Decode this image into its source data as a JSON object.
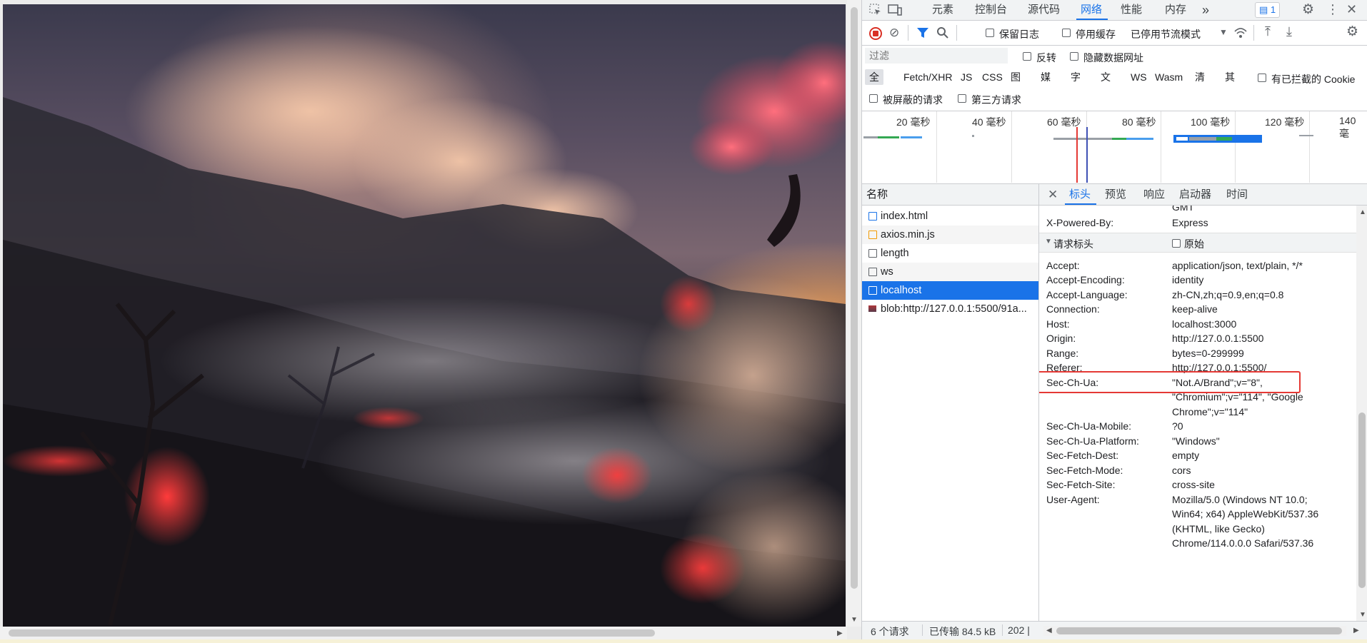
{
  "devtools": {
    "tabs": [
      "元素",
      "控制台",
      "源代码",
      "网络",
      "性能",
      "内存"
    ],
    "active_tab": "网络",
    "more_tabs": "»",
    "issues_count": "1",
    "toolbar": {
      "preserve_log": "保留日志",
      "disable_cache": "停用缓存",
      "throttling": "已停用节流模式"
    },
    "filter": {
      "placeholder": "过滤",
      "invert": "反转",
      "hide_data_urls": "隐藏数据网址"
    },
    "type_filters": [
      "全部",
      "Fetch/XHR",
      "JS",
      "CSS",
      "图片",
      "媒体",
      "字体",
      "文档",
      "WS",
      "Wasm",
      "清单",
      "其他"
    ],
    "blocked_cookies": "有已拦截的 Cookie",
    "blocked_requests": "被屏蔽的请求",
    "third_party": "第三方请求",
    "timeline_ticks": [
      "20 毫秒",
      "40 毫秒",
      "60 毫秒",
      "80 毫秒",
      "100 毫秒",
      "120 毫秒",
      "140 毫"
    ],
    "requests": {
      "header": "名称",
      "items": [
        {
          "name": "index.html",
          "icon": "document-icon"
        },
        {
          "name": "axios.min.js",
          "icon": "script-icon"
        },
        {
          "name": "length",
          "icon": "xhr-icon"
        },
        {
          "name": "ws",
          "icon": "websocket-icon"
        },
        {
          "name": "localhost",
          "icon": "xhr-icon"
        },
        {
          "name": "blob:http://127.0.0.1:5500/91a...",
          "icon": "image-icon"
        }
      ],
      "selected": "localhost"
    },
    "detail_tabs": [
      "标头",
      "预览",
      "响应",
      "启动器",
      "时间"
    ],
    "active_detail_tab": "标头",
    "headers": {
      "clipped_top": "GMT",
      "x_powered_by": {
        "key": "X-Powered-By:",
        "value": "Express"
      },
      "request_headers_title": "请求标头",
      "raw_label": "原始",
      "request_headers": [
        {
          "key": "Accept:",
          "value": "application/json, text/plain, */*"
        },
        {
          "key": "Accept-Encoding:",
          "value": "identity"
        },
        {
          "key": "Accept-Language:",
          "value": "zh-CN,zh;q=0.9,en;q=0.8"
        },
        {
          "key": "Connection:",
          "value": "keep-alive"
        },
        {
          "key": "Host:",
          "value": "localhost:3000"
        },
        {
          "key": "Origin:",
          "value": "http://127.0.0.1:5500"
        },
        {
          "key": "Range:",
          "value": "bytes=0-299999"
        },
        {
          "key": "Referer:",
          "value": "http://127.0.0.1:5500/"
        },
        {
          "key": "Sec-Ch-Ua:",
          "value": "\"Not.A/Brand\";v=\"8\",",
          "value2": "\"Chromium\";v=\"114\", \"Google",
          "value3": "Chrome\";v=\"114\""
        },
        {
          "key": "Sec-Ch-Ua-Mobile:",
          "value": "?0"
        },
        {
          "key": "Sec-Ch-Ua-Platform:",
          "value": "\"Windows\""
        },
        {
          "key": "Sec-Fetch-Dest:",
          "value": "empty"
        },
        {
          "key": "Sec-Fetch-Mode:",
          "value": "cors"
        },
        {
          "key": "Sec-Fetch-Site:",
          "value": "cross-site"
        },
        {
          "key": "User-Agent:",
          "value": "Mozilla/5.0 (Windows NT 10.0;",
          "value2": "Win64; x64) AppleWebKit/537.36",
          "value3": "(KHTML, like Gecko)",
          "value4": "Chrome/114.0.0.0 Safari/537.36"
        }
      ],
      "highlighted": "Range:"
    },
    "status": {
      "requests": "6 个请求",
      "transferred": "已传输 84.5 kB",
      "resources": "202 |"
    }
  },
  "colors": {
    "accent": "#1a73e8",
    "highlight_box": "#e53935",
    "record": "#d93025"
  }
}
